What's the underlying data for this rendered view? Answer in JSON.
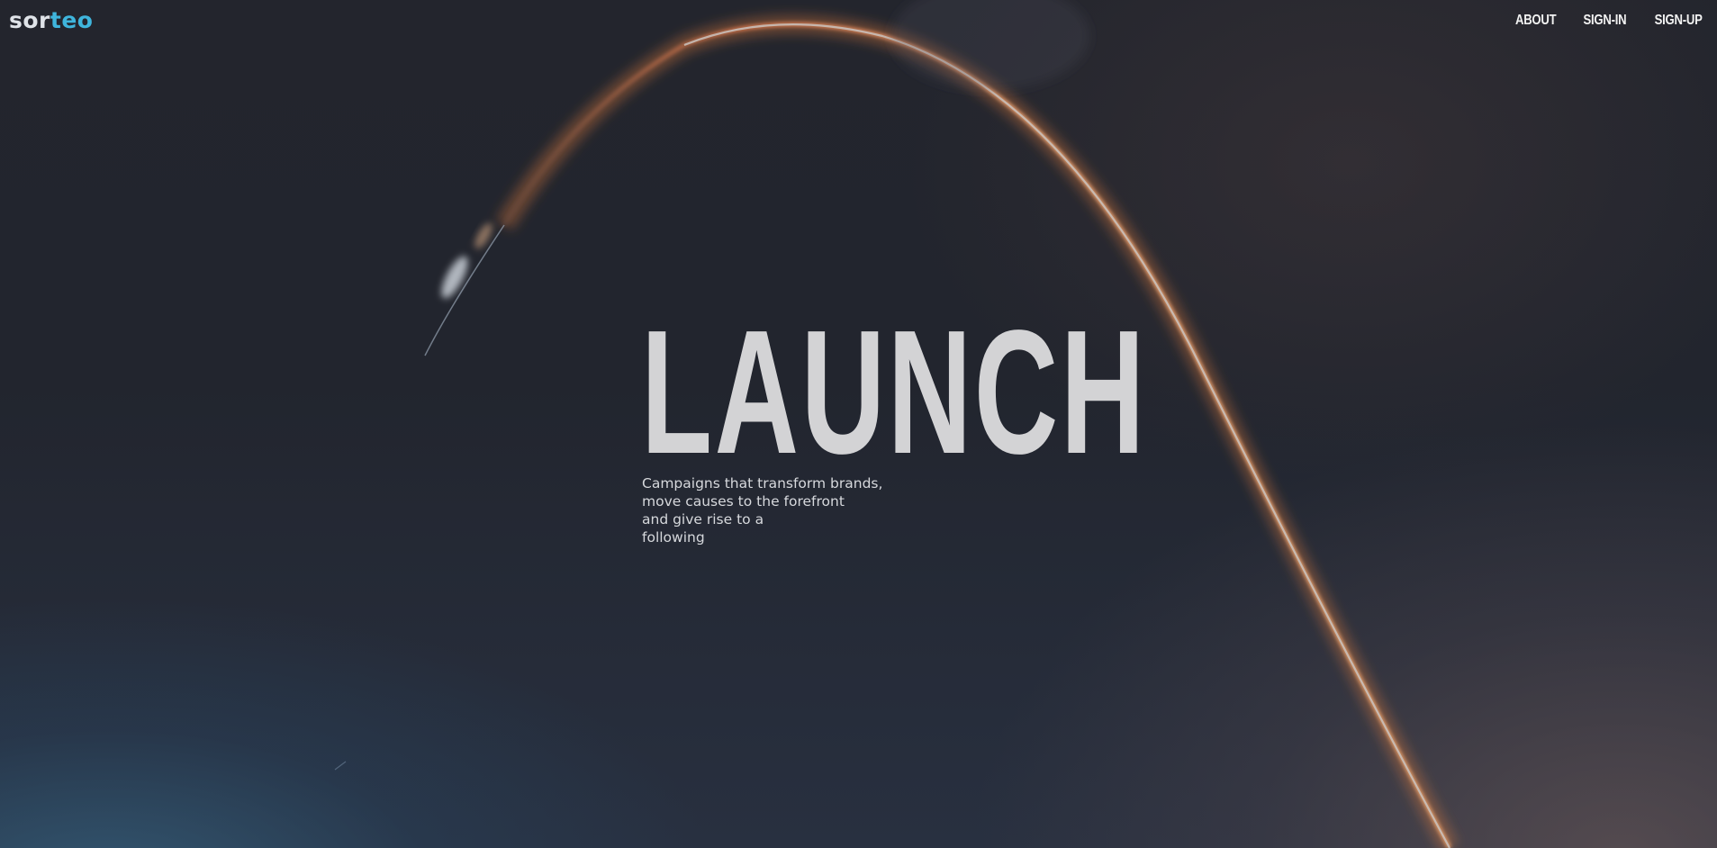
{
  "brand": {
    "logo_part_a": "sor",
    "logo_part_b": "teo",
    "accent_color": "#3fb5dc"
  },
  "nav": {
    "items": [
      {
        "label": "ABOUT"
      },
      {
        "label": "SIGN-IN"
      },
      {
        "label": "SIGN-UP"
      }
    ]
  },
  "hero": {
    "headline": "LAUNCH",
    "tagline_lines": [
      "Campaigns that transform brands,",
      "move causes to the forefront",
      "and give rise to a",
      "following"
    ],
    "background": "rocket-launch-arc-photo"
  }
}
